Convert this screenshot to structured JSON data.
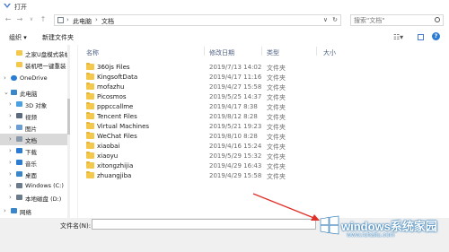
{
  "window": {
    "title": "打开"
  },
  "address": {
    "back": "←",
    "forward": "→",
    "dropdown": "∨",
    "up": "↑",
    "crumbs": [
      "此电脑",
      "文档"
    ],
    "search_placeholder": "搜索\"文档\""
  },
  "toolbar": {
    "organize": "组织 ▾",
    "new_folder": "新建文件夹"
  },
  "sidebar": {
    "items": [
      {
        "label": "之家U盘模式装机",
        "icon": "folder-icon",
        "color": "#f3c84d"
      },
      {
        "label": "装机吧一键重装",
        "icon": "folder-icon",
        "color": "#f3c84d"
      },
      {
        "label": "OneDrive",
        "icon": "cloud-icon",
        "color": "#2b7cd3"
      },
      {
        "label": "此电脑",
        "icon": "computer-icon",
        "color": "#3a86c8"
      },
      {
        "label": "3D 对象",
        "icon": "cube-icon",
        "color": "#4aa0e0"
      },
      {
        "label": "视频",
        "icon": "video-icon",
        "color": "#5b6b7d"
      },
      {
        "label": "图片",
        "icon": "picture-icon",
        "color": "#6a9ed4"
      },
      {
        "label": "文档",
        "icon": "document-icon",
        "color": "#8a99a8"
      },
      {
        "label": "下载",
        "icon": "download-icon",
        "color": "#2b7cd3"
      },
      {
        "label": "音乐",
        "icon": "music-icon",
        "color": "#2b7cd3"
      },
      {
        "label": "桌面",
        "icon": "desktop-icon",
        "color": "#3a86c8"
      },
      {
        "label": "Windows (C:)",
        "icon": "drive-icon",
        "color": "#6b7b8c"
      },
      {
        "label": "本地磁盘 (D:)",
        "icon": "drive-icon",
        "color": "#6b7b8c"
      },
      {
        "label": "网络",
        "icon": "network-icon",
        "color": "#3a86c8"
      }
    ]
  },
  "columns": {
    "name": "名称",
    "date": "修改日期",
    "type": "类型",
    "size": "大小"
  },
  "files": [
    {
      "name": "360js Files",
      "date": "2019/7/13 14:02",
      "type": "文件夹"
    },
    {
      "name": "KingsoftData",
      "date": "2019/4/17 11:16",
      "type": "文件夹"
    },
    {
      "name": "mofazhu",
      "date": "2019/4/27 15:58",
      "type": "文件夹"
    },
    {
      "name": "Picosmos",
      "date": "2019/5/25 14:37",
      "type": "文件夹"
    },
    {
      "name": "pppccallme",
      "date": "2019/4/17 8:38",
      "type": "文件夹"
    },
    {
      "name": "Tencent Files",
      "date": "2019/8/12 8:28",
      "type": "文件夹"
    },
    {
      "name": "Virtual Machines",
      "date": "2019/5/21 19:23",
      "type": "文件夹"
    },
    {
      "name": "WeChat Files",
      "date": "2019/8/10 8:28",
      "type": "文件夹"
    },
    {
      "name": "xiaobai",
      "date": "2019/4/16 15:24",
      "type": "文件夹"
    },
    {
      "name": "xiaoyu",
      "date": "2019/5/29 15:32",
      "type": "文件夹"
    },
    {
      "name": "xitongzhijia",
      "date": "2019/4/29 16:43",
      "type": "文件夹"
    },
    {
      "name": "zhuangjiba",
      "date": "2019/4/29 15:58",
      "type": "文件夹"
    }
  ],
  "footer": {
    "filename_label": "文件名(N):",
    "filename_value": ""
  },
  "watermark": {
    "line1": "windows系统家园",
    "line2": "www.ruhaitu.com"
  },
  "colors": {
    "folder": "#f3c84d",
    "selected": "#d9d9d9",
    "header": "#4d6082",
    "arrow": "#e0302a"
  }
}
